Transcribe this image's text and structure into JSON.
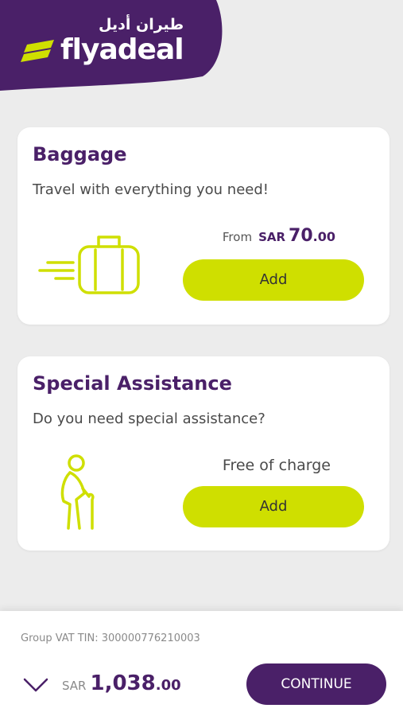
{
  "brand": {
    "name_en": "flyadeal",
    "name_ar": "طيران أديل",
    "purple": "#4a2068",
    "lime": "#cfdf00"
  },
  "baggage": {
    "title": "Baggage",
    "subtitle": "Travel with everything you need!",
    "from_label": "From",
    "currency": "SAR",
    "price_int": "70",
    "price_dec": ".00",
    "add_label": "Add",
    "icon": "suitcase-icon"
  },
  "assistance": {
    "title": "Special Assistance",
    "subtitle": "Do you need special assistance?",
    "price_label": "Free of charge",
    "add_label": "Add",
    "icon": "elderly-person-icon"
  },
  "footer": {
    "vat": "Group VAT TIN: 300000776210003",
    "currency": "SAR",
    "total_int": "1,038",
    "total_dec": ".00",
    "continue_label": "CONTINUE",
    "expand_icon": "chevron-down-icon"
  }
}
